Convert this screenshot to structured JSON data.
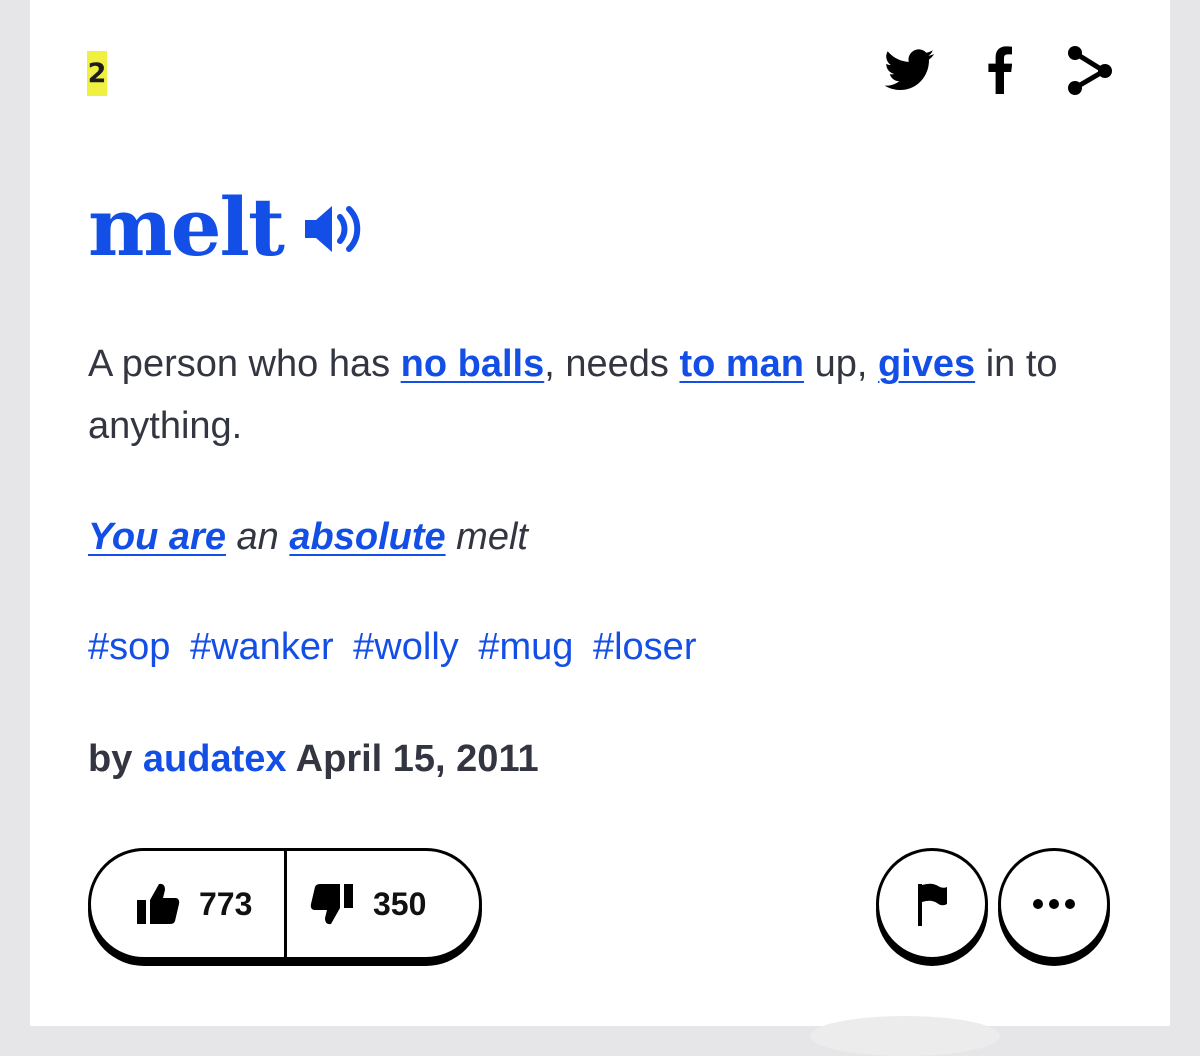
{
  "rank": "2",
  "share": {
    "twitter_icon": "twitter-bird-icon",
    "facebook_icon": "facebook-f-icon",
    "more_icon": "share-icon"
  },
  "entry": {
    "word": "melt",
    "meaning": {
      "t1": "A person who has ",
      "l1": "no balls",
      "t2": ", needs ",
      "l2": "to man",
      "t3": " up, ",
      "l3": "gives",
      "t4": " in to anything."
    },
    "example": {
      "l1": "You are",
      "t1": " an ",
      "l2": "absolute",
      "t2": " melt"
    },
    "tags": [
      "#sop",
      "#wanker",
      "#wolly",
      "#mug",
      "#loser"
    ],
    "byline": {
      "by": "by ",
      "author": "audatex",
      "date": " April 15, 2011"
    }
  },
  "votes": {
    "up_count": "773",
    "down_count": "350"
  },
  "colors": {
    "link": "#134fe6",
    "text": "#333640",
    "rank_highlight": "#f0f043",
    "page_bg": "#e6e6e8"
  }
}
